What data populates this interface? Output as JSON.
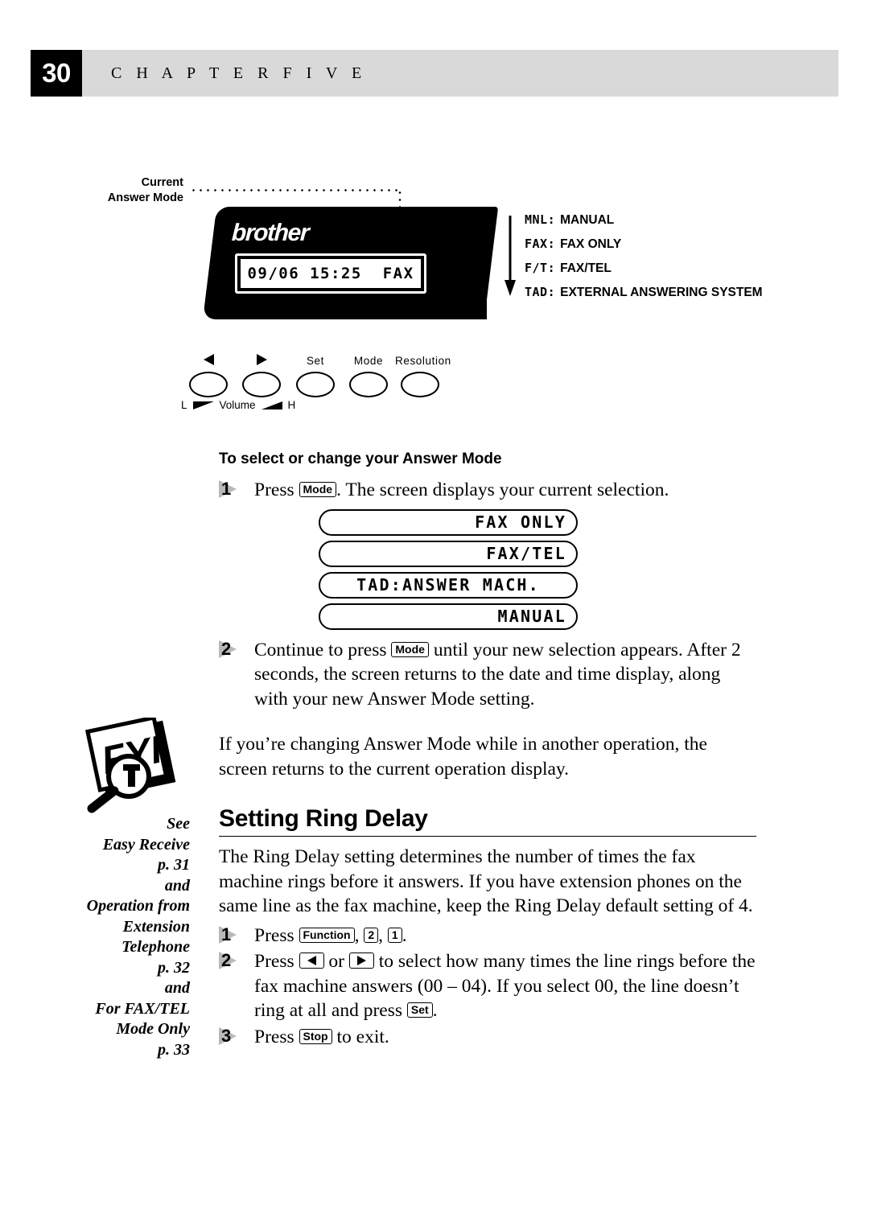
{
  "header": {
    "page_number": "30",
    "chapter_label": "C H A P T E R   F I V E"
  },
  "figure": {
    "callout_line1": "Current",
    "callout_line2": "Answer Mode",
    "brand_logo": "brother",
    "lcd_display": "09/06 15:25  FAX",
    "legend": [
      {
        "code": "MNL:",
        "name": "MANUAL"
      },
      {
        "code": "FAX:",
        "name": "FAX ONLY"
      },
      {
        "code": "F/T:",
        "name": "FAX/TEL"
      },
      {
        "code": "TAD:",
        "name": "EXTERNAL ANSWERING SYSTEM"
      }
    ],
    "buttons": [
      {
        "caption": "",
        "icon": "arrow-left-icon"
      },
      {
        "caption": "",
        "icon": "arrow-right-icon"
      },
      {
        "caption": "Set",
        "icon": ""
      },
      {
        "caption": "Mode",
        "icon": ""
      },
      {
        "caption": "Resolution",
        "icon": ""
      }
    ],
    "volume_low": "L",
    "volume_label": "Volume",
    "volume_high": "H"
  },
  "answer_mode": {
    "subheading": "To select or change your Answer Mode",
    "step1_pre": "Press",
    "step1_key": "Mode",
    "step1_post": ". The screen displays your current selection.",
    "step1_number": "1",
    "lcd_examples": [
      "FAX ONLY",
      "FAX/TEL",
      "TAD:ANSWER MACH.",
      "MANUAL"
    ],
    "step2_number": "2",
    "step2_pre": "Continue to press",
    "step2_key": "Mode",
    "step2_post": "until your new selection appears. After 2 seconds, the screen returns to the date and time display, along with your new Answer Mode setting.",
    "fyi_note": "If you’re changing Answer Mode while in another operation, the screen returns to the current operation display."
  },
  "ring_delay": {
    "heading": "Setting Ring Delay",
    "intro": "The Ring Delay setting determines the number of times the fax machine rings before it answers. If you have extension phones on the same line as the fax machine, keep the Ring Delay default setting of 4.",
    "step1_number": "1",
    "step1_pre": "Press",
    "step1_key1": "Function",
    "step1_sep1": ",",
    "step1_key2": "2",
    "step1_sep2": ",",
    "step1_key3": "1",
    "step1_end": ".",
    "step2_number": "2",
    "step2_pre": "Press",
    "step2_or": "or",
    "step2_mid": "to select how many times the line rings before the fax machine answers (00 – 04). If you select 00, the line doesn’t ring at all and press",
    "step2_key_set": "Set",
    "step2_end": ".",
    "step3_number": "3",
    "step3_pre": "Press",
    "step3_key": "Stop",
    "step3_post": "to exit."
  },
  "margin_note": {
    "lines": [
      "See",
      "Easy Receive",
      "p. 31",
      "and",
      "Operation from",
      "Extension",
      "Telephone",
      "p. 32",
      "and",
      "For FAX/TEL",
      "Mode Only",
      "p. 33"
    ]
  },
  "icons": {
    "fyi": "fyi-magnifier-icon",
    "down_arrow": "down-arrow-icon"
  },
  "colors": {
    "header_bar": "#d9d9d9",
    "page_box": "#000000",
    "step_marker": "#b9b9b9",
    "panel": "#000000"
  }
}
